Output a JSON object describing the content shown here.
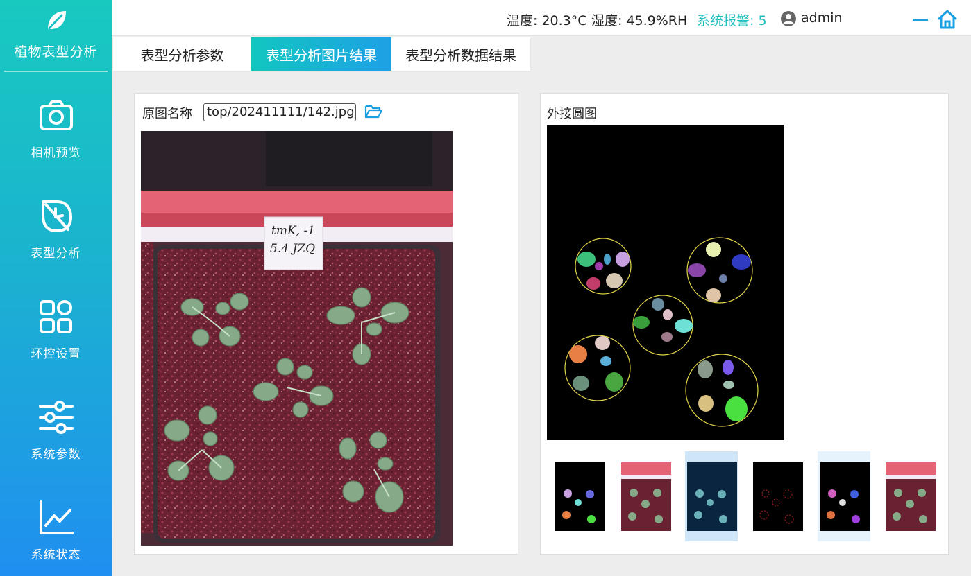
{
  "app": {
    "title": "植物表型分析",
    "logo_icon": "leaf-icon"
  },
  "sidebar": {
    "items": [
      {
        "label": "相机预览",
        "icon": "camera-icon"
      },
      {
        "label": "表型分析",
        "icon": "leaf-outline-icon"
      },
      {
        "label": "环控设置",
        "icon": "grid-apps-icon"
      },
      {
        "label": "系统参数",
        "icon": "sliders-icon"
      },
      {
        "label": "系统状态",
        "icon": "line-chart-icon"
      }
    ]
  },
  "header": {
    "temperature": "温度: 20.3°C",
    "humidity": "湿度: 45.9%RH",
    "alarm": "系统报警: 5",
    "user": "admin",
    "accent_color": "#1fbfbe"
  },
  "tabs": [
    {
      "label": "表型分析参数",
      "active": false
    },
    {
      "label": "表型分析图片结果",
      "active": true
    },
    {
      "label": "表型分析数据结果",
      "active": false
    }
  ],
  "left_panel": {
    "label": "原图名称",
    "file_value": "top/202411111/142.jpg"
  },
  "right_panel": {
    "label": "外接圆图"
  },
  "photo": {
    "tag_line1": "tmK, -1",
    "tag_line2": "5.4  JZQ"
  },
  "thumbnails": [
    {
      "kind": "segmentation",
      "selected": false
    },
    {
      "kind": "original",
      "selected": false
    },
    {
      "kind": "overlay-dark",
      "selected": true
    },
    {
      "kind": "red-points",
      "selected": false
    },
    {
      "kind": "segmentation-alt",
      "selected": "light"
    },
    {
      "kind": "original-alt",
      "selected": false
    }
  ]
}
